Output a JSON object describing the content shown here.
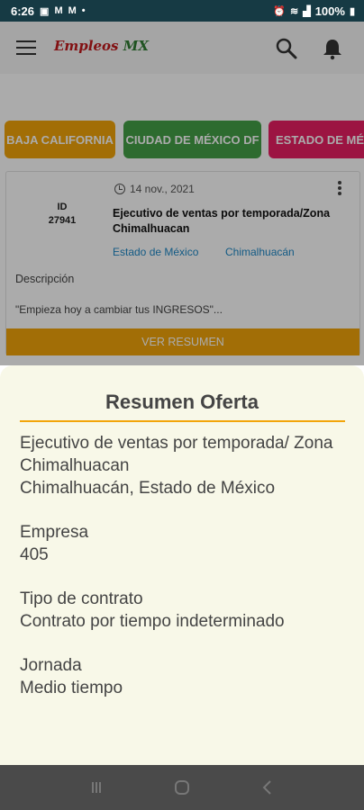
{
  "status_bar": {
    "time": "6:26",
    "battery": "100%"
  },
  "app": {
    "logo_part1": "Empleos ",
    "logo_part2": "MX"
  },
  "chips": [
    {
      "label": "BAJA CALIFORNIA",
      "color": "#f2a50a"
    },
    {
      "label": "CIUDAD DE MÉXICO DF",
      "color": "#43a047"
    },
    {
      "label": "ESTADO DE MÉXICO",
      "color": "#e91e63"
    }
  ],
  "card": {
    "id_label": "ID",
    "id_value": "27941",
    "date": "14 nov., 2021",
    "title": "Ejecutivo de ventas por temporada/Zona Chimalhuacan",
    "state": "Estado de México",
    "city": "Chimalhuacán",
    "description_label": "Descripción",
    "description_text": "\"Empieza hoy a cambiar tus INGRESOS\"...",
    "button_label": "VER RESUMEN"
  },
  "sheet": {
    "title": "Resumen Oferta",
    "job_title": "Ejecutivo de ventas por temporada/ Zona Chimalhuacan",
    "location": "Chimalhuacán, Estado de México",
    "company_label": "Empresa",
    "company_value": "405",
    "contract_label": "Tipo de contrato",
    "contract_value": "Contrato por tiempo indeterminado",
    "schedule_label": "Jornada",
    "schedule_value": "Medio tiempo"
  },
  "colors": {
    "accent": "#f2a50a",
    "link": "#1e88c7",
    "status_bar": "#163a44",
    "sheet_bg": "#f8f8e8"
  }
}
